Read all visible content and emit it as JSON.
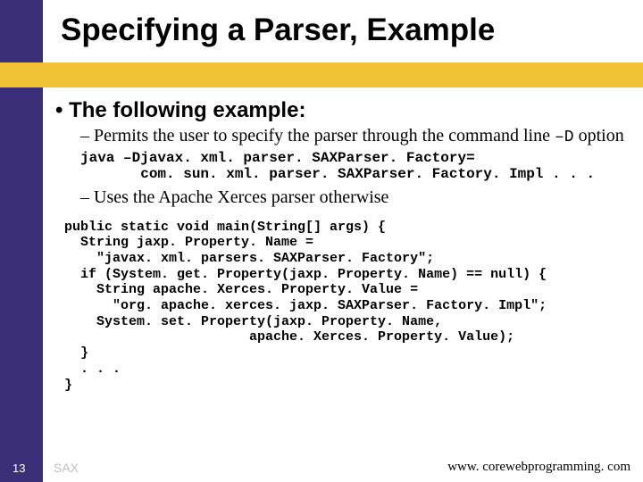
{
  "title": "Specifying a Parser, Example",
  "l1": "The following example:",
  "l2a_pre": "Permits the user to specify the parser through the command line ",
  "l2a_code": "–D",
  "l2a_post": " option",
  "code1": "java –Djavax. xml. parser. SAXParser. Factory=\n       com. sun. xml. parser. SAXParser. Factory. Impl . . .",
  "l2b": "Uses the Apache Xerces parser otherwise",
  "code2": "public static void main(String[] args) {\n  String jaxp. Property. Name =\n    \"javax. xml. parsers. SAXParser. Factory\";\n  if (System. get. Property(jaxp. Property. Name) == null) {\n    String apache. Xerces. Property. Value =\n      \"org. apache. xerces. jaxp. SAXParser. Factory. Impl\";\n    System. set. Property(jaxp. Property. Name,\n                       apache. Xerces. Property. Value);\n  }\n  . . .\n}",
  "page_num": "13",
  "footer_left": "SAX",
  "footer_right": "www. corewebprogramming. com"
}
